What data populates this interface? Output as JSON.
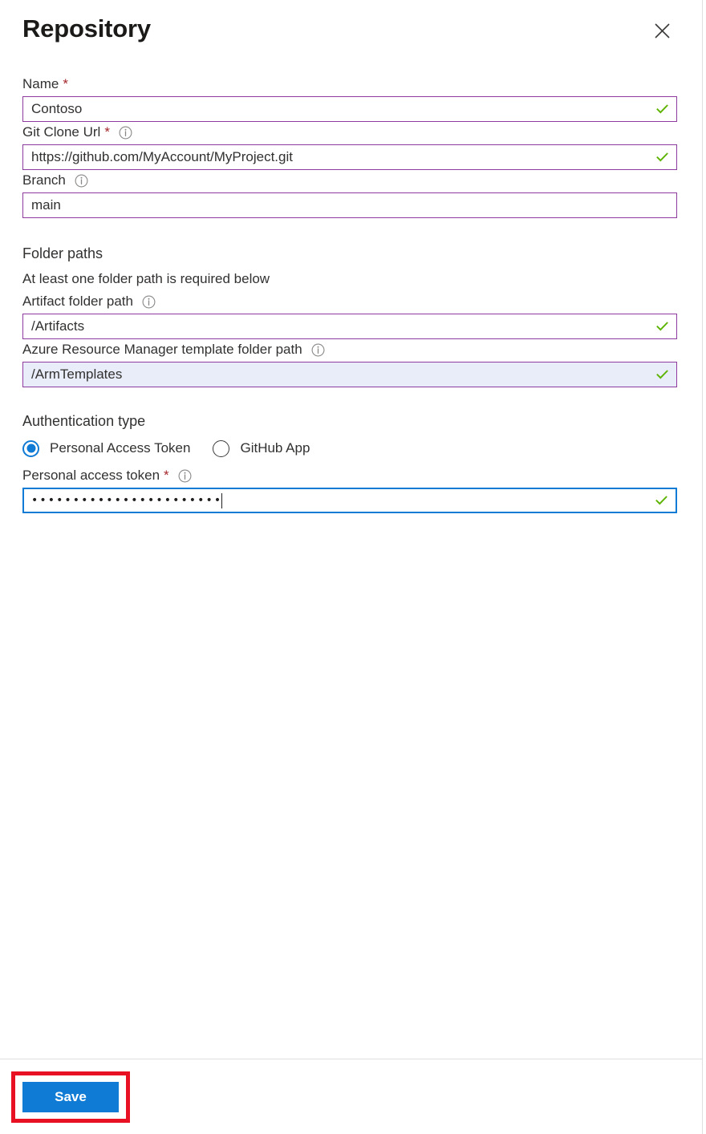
{
  "blade": {
    "title": "Repository",
    "close_label": "Close",
    "close_icon": "close-icon"
  },
  "form": {
    "fields": [
      {
        "label": "Name",
        "required": true,
        "has_info": false,
        "value": "Contoso",
        "valid": true,
        "state": "normal"
      },
      {
        "label": "Git Clone Url",
        "required": true,
        "has_info": true,
        "value": "https://github.com/MyAccount/MyProject.git",
        "valid": true,
        "state": "normal"
      },
      {
        "label": "Branch",
        "required": false,
        "has_info": true,
        "value": "main",
        "valid": false,
        "state": "normal"
      }
    ],
    "folder_paths": {
      "heading": "Folder paths",
      "subtext": "At least one folder path is required below",
      "fields": [
        {
          "label": "Artifact folder path",
          "required": false,
          "has_info": true,
          "value": "/Artifacts",
          "valid": true,
          "state": "normal"
        },
        {
          "label": "Azure Resource Manager template folder path",
          "required": false,
          "has_info": true,
          "value": "/ArmTemplates",
          "valid": true,
          "state": "highlight"
        }
      ]
    },
    "authentication": {
      "heading": "Authentication type",
      "options": [
        {
          "label": "Personal Access Token",
          "selected": true
        },
        {
          "label": "GitHub App",
          "selected": false
        }
      ],
      "token_field": {
        "label": "Personal access token",
        "required": true,
        "has_info": true,
        "value": "•••••••••••••••••••••••",
        "valid": true,
        "state": "focused"
      }
    }
  },
  "footer": {
    "save_label": "Save"
  },
  "colors": {
    "accent": "#0f7bd4",
    "input_border": "#8e3a9e",
    "valid_check": "#5cb300",
    "required_star": "#a4262c",
    "highlight_bg": "#e8edf9",
    "annotation": "#e81123"
  }
}
